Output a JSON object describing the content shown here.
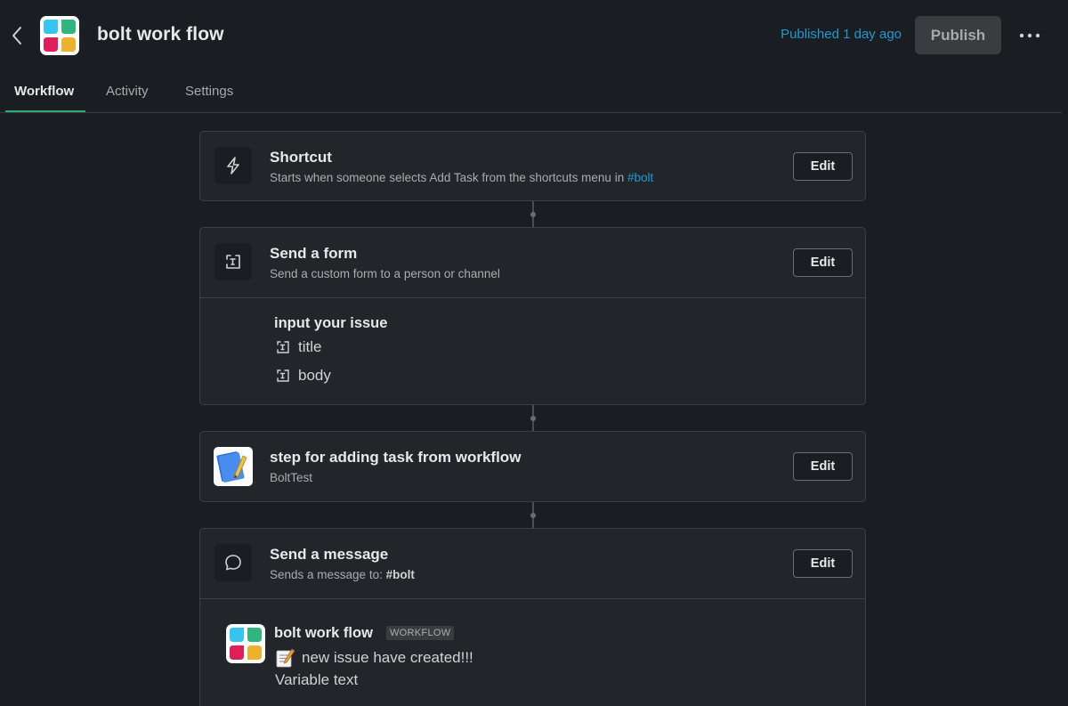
{
  "header": {
    "title": "bolt work flow",
    "status": "Published 1 day ago",
    "publish_label": "Publish"
  },
  "tabs": [
    {
      "label": "Workflow",
      "active": true
    },
    {
      "label": "Activity",
      "active": false
    },
    {
      "label": "Settings",
      "active": false
    }
  ],
  "steps": [
    {
      "title": "Shortcut",
      "subtitle": "Starts when someone selects Add Task from the shortcuts menu in",
      "channel": "#bolt",
      "icon": "lightning-icon",
      "edit_label": "Edit"
    },
    {
      "title": "Send a form",
      "subtitle": "Send a custom form to a person or channel",
      "icon": "form-icon",
      "edit_label": "Edit",
      "form": {
        "label": "input your issue",
        "fields": [
          "title",
          "body"
        ]
      }
    },
    {
      "title": "step for adding task from workflow",
      "subtitle": "BoltTest",
      "icon": "notebook-icon",
      "edit_label": "Edit"
    },
    {
      "title": "Send a message",
      "subtitle": "Sends a message to:",
      "channel": "#bolt",
      "icon": "speech-bubble-icon",
      "edit_label": "Edit",
      "message": {
        "author": "bolt work flow",
        "badge": "WORKFLOW",
        "lines": [
          "new issue have created!!!",
          "Variable text"
        ]
      }
    }
  ],
  "colors": {
    "background": "#1a1d21",
    "card": "#222529",
    "link": "#1d9bd1",
    "active_tab": "#2bac76",
    "logo_blue": "#36c5f0",
    "logo_green": "#2eb67d",
    "logo_red": "#e01e5a",
    "logo_yellow": "#ecb22e"
  }
}
